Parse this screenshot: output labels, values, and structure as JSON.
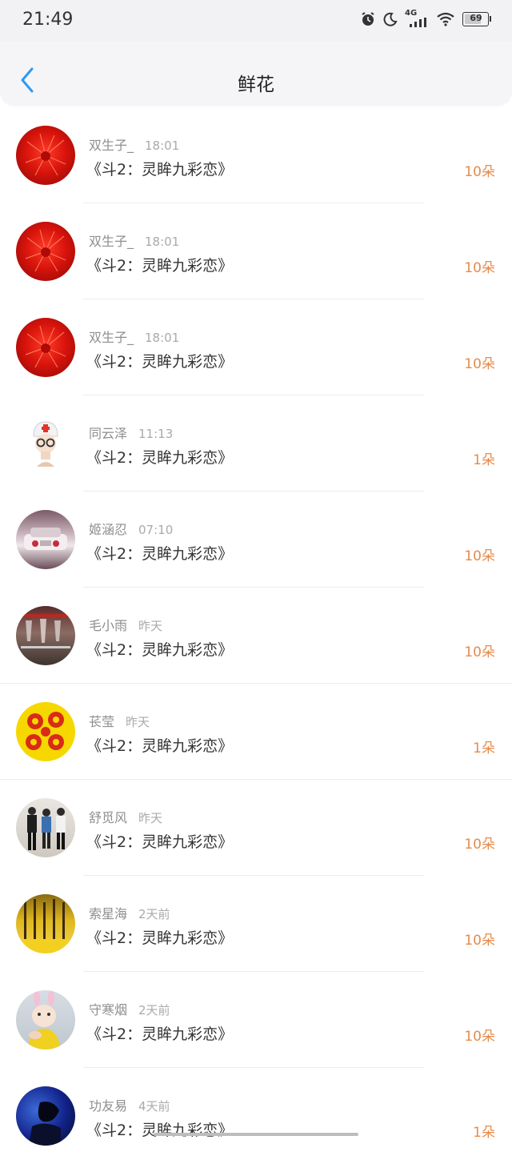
{
  "status_bar": {
    "time": "21:49",
    "network": "4G",
    "battery": "69",
    "icons": [
      "alarm-icon",
      "moon-icon",
      "signal-icon",
      "wifi-icon",
      "battery-icon"
    ]
  },
  "nav": {
    "title": "鲜花",
    "back_icon": "chevron-left-icon"
  },
  "colors": {
    "accent": "#2b9af3",
    "count": "#e88a4a"
  },
  "items": [
    {
      "name": "双生子_",
      "time": "18:01",
      "book": "《斗2：灵眸九彩恋》",
      "count": "10朵",
      "avatar": "red-flower-avatar"
    },
    {
      "name": "双生子_",
      "time": "18:01",
      "book": "《斗2：灵眸九彩恋》",
      "count": "10朵",
      "avatar": "red-flower-avatar"
    },
    {
      "name": "双生子_",
      "time": "18:01",
      "book": "《斗2：灵眸九彩恋》",
      "count": "10朵",
      "avatar": "red-flower-avatar"
    },
    {
      "name": "同云泽",
      "time": "11:13",
      "book": "《斗2：灵眸九彩恋》",
      "count": "1朵",
      "avatar": "nurse-figure-avatar"
    },
    {
      "name": "姬涵忍",
      "time": "07:10",
      "book": "《斗2：灵眸九彩恋》",
      "count": "10朵",
      "avatar": "car-avatar"
    },
    {
      "name": "毛小雨",
      "time": "昨天",
      "book": "《斗2：灵眸九彩恋》",
      "count": "10朵",
      "avatar": "glasses-avatar"
    },
    {
      "name": "苌莹",
      "time": "昨天",
      "book": "《斗2：灵眸九彩恋》",
      "count": "1朵",
      "avatar": "yellow-flower-avatar"
    },
    {
      "name": "舒觅风",
      "time": "昨天",
      "book": "《斗2：灵眸九彩恋》",
      "count": "10朵",
      "avatar": "people-avatar"
    },
    {
      "name": "索星海",
      "time": "2天前",
      "book": "《斗2：灵眸九彩恋》",
      "count": "10朵",
      "avatar": "ginkgo-avatar"
    },
    {
      "name": "守寒烟",
      "time": "2天前",
      "book": "《斗2：灵眸九彩恋》",
      "count": "10朵",
      "avatar": "teletubby-avatar"
    },
    {
      "name": "功友易",
      "time": "4天前",
      "book": "《斗2：灵眸九彩恋》",
      "count": "1朵",
      "avatar": "dark-blue-avatar"
    }
  ]
}
